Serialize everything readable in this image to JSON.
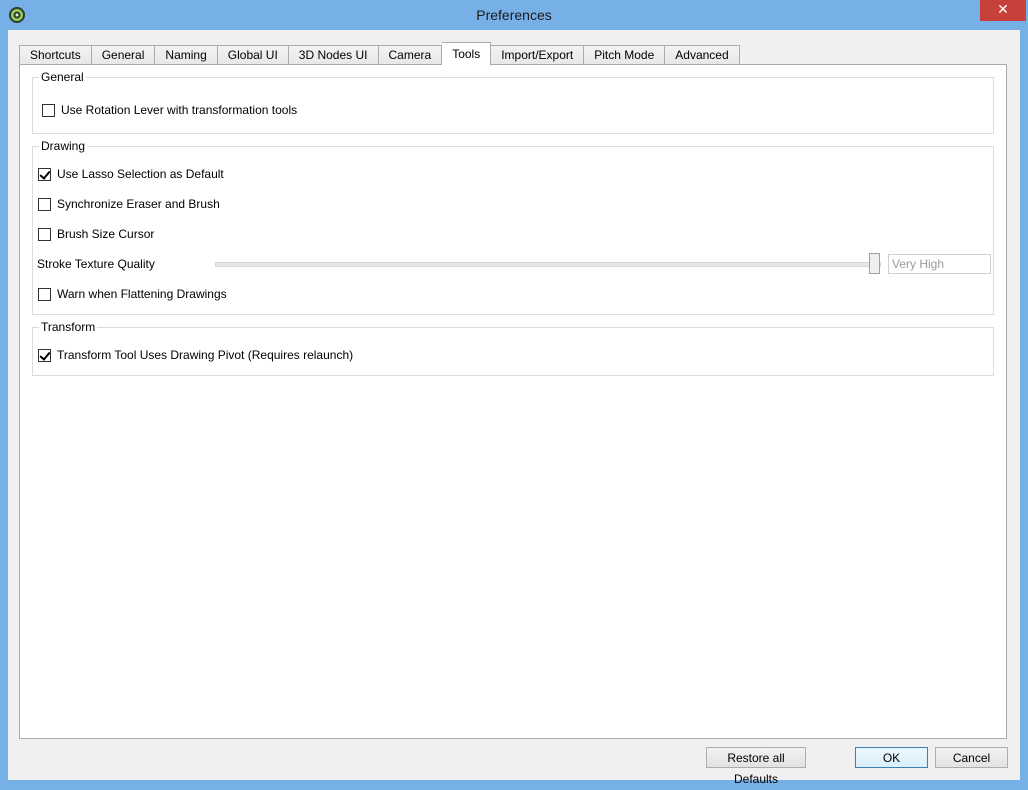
{
  "window": {
    "title": "Preferences",
    "close_label": "✕"
  },
  "tabs": [
    {
      "label": "Shortcuts"
    },
    {
      "label": "General"
    },
    {
      "label": "Naming"
    },
    {
      "label": "Global UI"
    },
    {
      "label": "3D Nodes UI"
    },
    {
      "label": "Camera"
    },
    {
      "label": "Tools",
      "active": true
    },
    {
      "label": "Import/Export"
    },
    {
      "label": "Pitch Mode"
    },
    {
      "label": "Advanced"
    }
  ],
  "groups": {
    "general": {
      "title": "General",
      "items": [
        {
          "label": "Use Rotation Lever with transformation tools",
          "checked": false
        }
      ]
    },
    "drawing": {
      "title": "Drawing",
      "items": [
        {
          "label": "Use Lasso Selection as Default",
          "checked": true
        },
        {
          "label": "Synchronize Eraser and Brush",
          "checked": false
        },
        {
          "label": "Brush Size Cursor",
          "checked": false
        }
      ],
      "slider": {
        "label": "Stroke Texture Quality",
        "value_text": "Very High",
        "fraction": 1.0
      },
      "last_item": {
        "label": "Warn when Flattening Drawings",
        "checked": false
      }
    },
    "transform": {
      "title": "Transform",
      "items": [
        {
          "label": "Transform Tool Uses Drawing Pivot (Requires relaunch)",
          "checked": true
        }
      ]
    }
  },
  "buttons": {
    "restore": "Restore all Defaults",
    "ok": "OK",
    "cancel": "Cancel"
  }
}
